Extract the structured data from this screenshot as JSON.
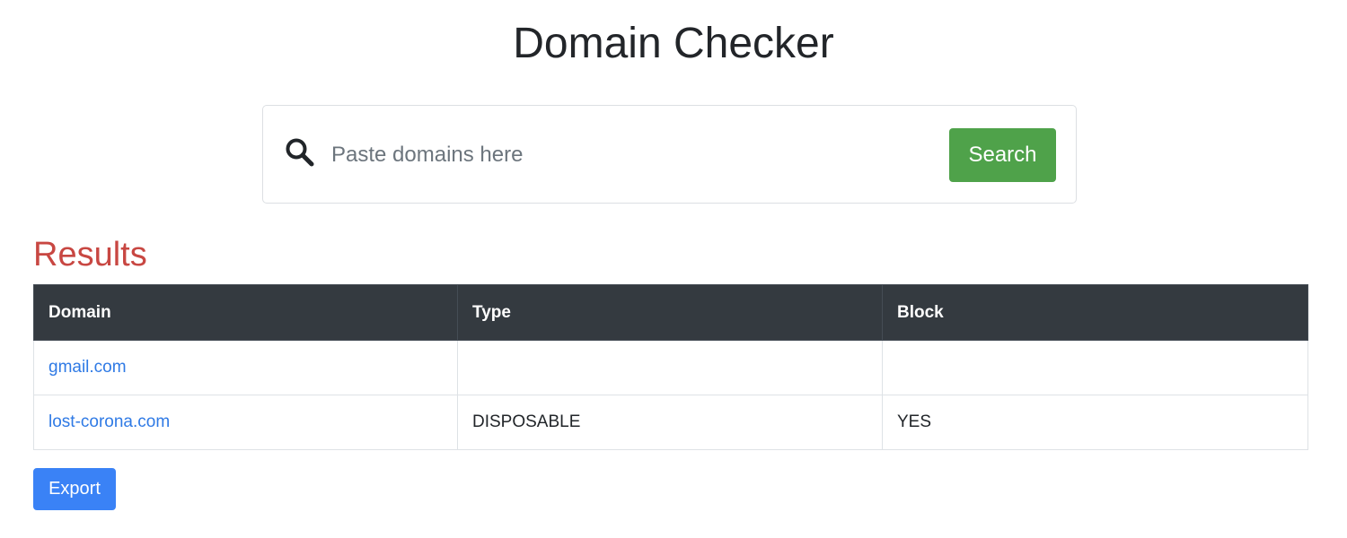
{
  "page": {
    "title": "Domain Checker"
  },
  "search": {
    "placeholder": "Paste domains here",
    "value": "",
    "button_label": "Search",
    "icon": "search-icon",
    "button_color": "#4fa24a"
  },
  "results": {
    "heading": "Results",
    "heading_color": "#c84742",
    "columns": [
      "Domain",
      "Type",
      "Block"
    ],
    "rows": [
      {
        "domain": "gmail.com",
        "type": "",
        "block": ""
      },
      {
        "domain": "lost-corona.com",
        "type": "DISPOSABLE",
        "block": "YES"
      }
    ]
  },
  "actions": {
    "export_label": "Export",
    "export_color": "#3a82f6"
  }
}
